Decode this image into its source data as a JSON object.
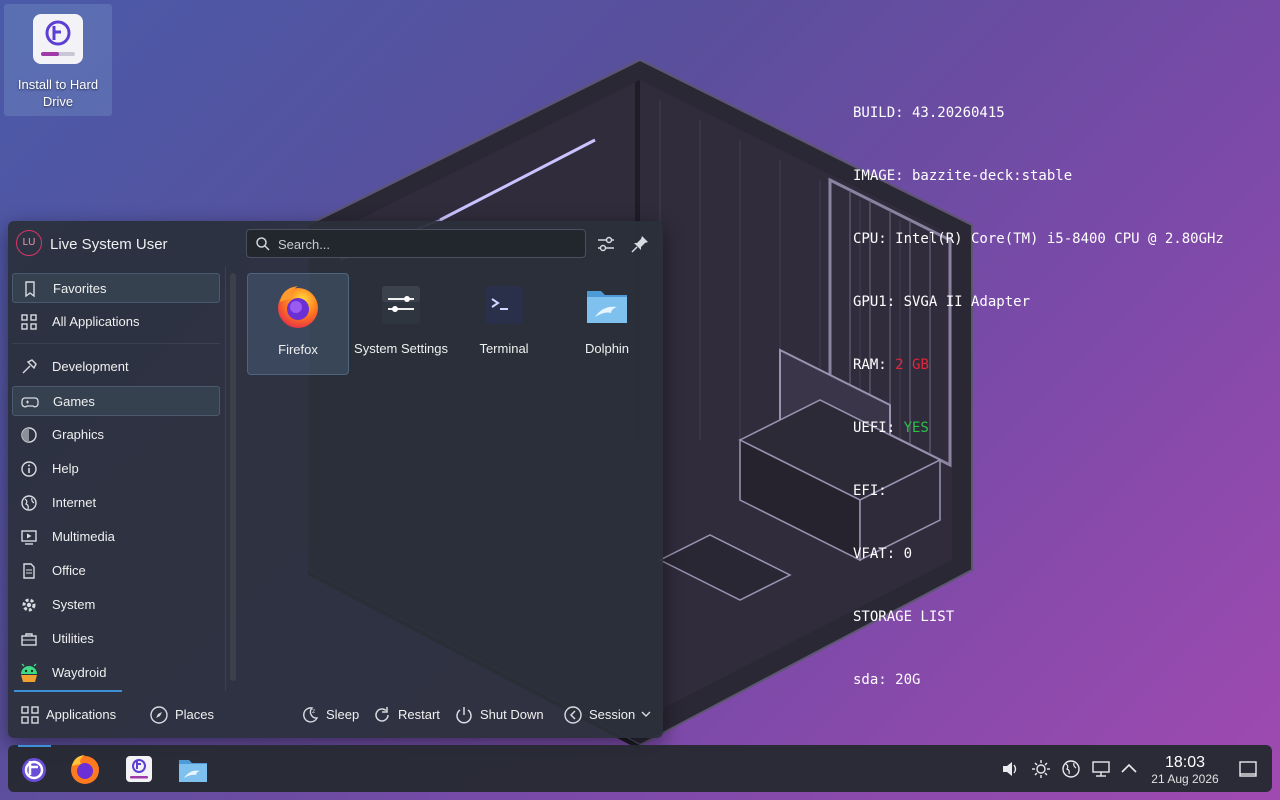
{
  "desktop": {
    "icons": [
      {
        "label": "Install to Hard Drive"
      }
    ]
  },
  "sysinfo": {
    "build": "BUILD: 43.20260415",
    "image": "IMAGE: bazzite-deck:stable",
    "cpu": "CPU: Intel(R) Core(TM) i5-8400 CPU @ 2.80GHz",
    "gpu": "GPU1: SVGA II Adapter",
    "ram_label": "RAM: ",
    "ram_value": "2 GB",
    "uefi_label": "UEFI: ",
    "uefi_value": "YES",
    "efi": "EFI:",
    "vfat": "VFAT: 0",
    "storage": "STORAGE LIST",
    "disk": "sda: 20G",
    "colors": {
      "warn": "#e0283a",
      "ok": "#2cc14a"
    }
  },
  "launcher": {
    "user": {
      "initials": "LU",
      "name": "Live System User"
    },
    "search": {
      "placeholder": "Search..."
    },
    "sidebar": {
      "items": [
        {
          "label": "Favorites",
          "icon": "bookmark-icon",
          "selected": true
        },
        {
          "label": "All Applications",
          "icon": "grid-icon"
        },
        {
          "label": "Development",
          "icon": "hammer-icon"
        },
        {
          "label": "Games",
          "icon": "gamepad-icon",
          "selected": true
        },
        {
          "label": "Graphics",
          "icon": "palette-icon"
        },
        {
          "label": "Help",
          "icon": "info-icon"
        },
        {
          "label": "Internet",
          "icon": "globe-icon"
        },
        {
          "label": "Multimedia",
          "icon": "media-icon"
        },
        {
          "label": "Office",
          "icon": "document-icon"
        },
        {
          "label": "System",
          "icon": "gear-icon"
        },
        {
          "label": "Utilities",
          "icon": "toolbox-icon"
        },
        {
          "label": "Waydroid",
          "icon": "android-icon"
        }
      ]
    },
    "apps": [
      {
        "label": "Firefox",
        "icon": "firefox-icon"
      },
      {
        "label": "System Settings",
        "icon": "settings-icon"
      },
      {
        "label": "Terminal",
        "icon": "terminal-icon"
      },
      {
        "label": "Dolphin",
        "icon": "folder-icon"
      }
    ],
    "footer": {
      "applications": "Applications",
      "places": "Places",
      "sleep": "Sleep",
      "restart": "Restart",
      "shutdown": "Shut Down",
      "session": "Session"
    }
  },
  "taskbar": {
    "items": [
      "bazzite-launcher-icon",
      "firefox-icon",
      "installer-icon",
      "dolphin-icon"
    ],
    "tray": [
      "volume-icon",
      "brightness-icon",
      "network-globe-icon",
      "wired-network-icon",
      "chevron-up-icon"
    ],
    "clock": {
      "time": "18:03",
      "date": "21 Aug 2026"
    }
  }
}
